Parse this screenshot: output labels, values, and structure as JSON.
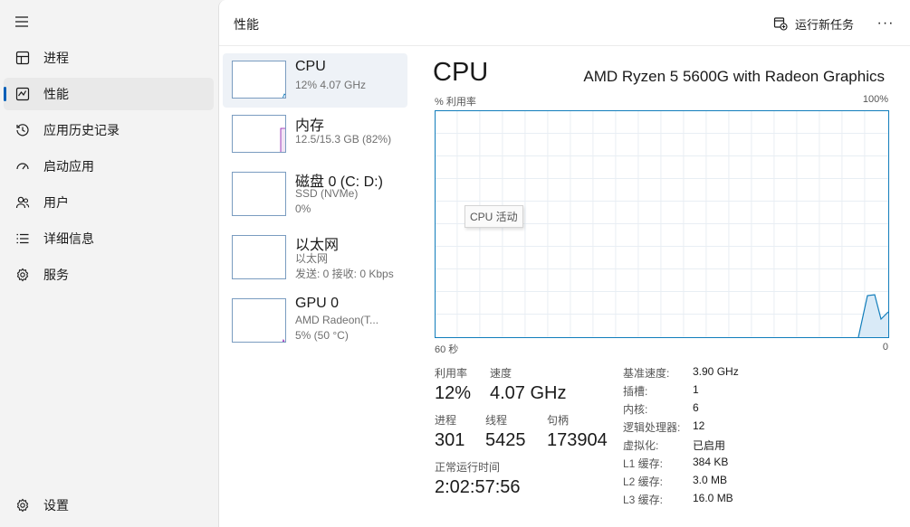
{
  "sidebar": {
    "items": [
      {
        "label": "进程",
        "icon": "processes-icon"
      },
      {
        "label": "性能",
        "icon": "performance-icon"
      },
      {
        "label": "应用历史记录",
        "icon": "history-icon"
      },
      {
        "label": "启动应用",
        "icon": "startup-icon"
      },
      {
        "label": "用户",
        "icon": "users-icon"
      },
      {
        "label": "详细信息",
        "icon": "details-icon"
      },
      {
        "label": "服务",
        "icon": "services-icon"
      }
    ],
    "active_index": 1,
    "settings_label": "设置"
  },
  "header": {
    "title": "性能",
    "run_task_label": "运行新任务",
    "more_label": "···"
  },
  "devices": [
    {
      "name": "CPU",
      "lines": [
        "12% 4.07 GHz"
      ]
    },
    {
      "name": "内存",
      "lines": [
        "12.5/15.3 GB (82%)"
      ]
    },
    {
      "name": "磁盘 0 (C: D:)",
      "lines": [
        "SSD (NVMe)",
        "0%"
      ]
    },
    {
      "name": "以太网",
      "lines": [
        "以太网",
        "发送: 0 接收: 0 Kbps"
      ]
    },
    {
      "name": "GPU 0",
      "lines": [
        "AMD Radeon(T...",
        "5% (50 °C)"
      ]
    }
  ],
  "detail": {
    "title": "CPU",
    "model": "AMD Ryzen 5 5600G with Radeon Graphics",
    "graph_label_left": "% 利用率",
    "graph_label_right": "100%",
    "axis_left": "60 秒",
    "axis_right": "0",
    "tooltip": "CPU 活动",
    "stats": {
      "utilization": {
        "label": "利用率",
        "value": "12%"
      },
      "speed": {
        "label": "速度",
        "value": "4.07 GHz"
      },
      "processes": {
        "label": "进程",
        "value": "301"
      },
      "threads": {
        "label": "线程",
        "value": "5425"
      },
      "handles": {
        "label": "句柄",
        "value": "173904"
      },
      "uptime": {
        "label": "正常运行时间",
        "value": "2:02:57:56"
      }
    },
    "specs": [
      {
        "key": "基准速度:",
        "value": "3.90 GHz"
      },
      {
        "key": "插槽:",
        "value": "1"
      },
      {
        "key": "内核:",
        "value": "6"
      },
      {
        "key": "逻辑处理器:",
        "value": "12"
      },
      {
        "key": "虚拟化:",
        "value": "已启用"
      },
      {
        "key": "L1 缓存:",
        "value": "384 KB"
      },
      {
        "key": "L2 缓存:",
        "value": "3.0 MB"
      },
      {
        "key": "L3 缓存:",
        "value": "16.0 MB"
      }
    ]
  },
  "colors": {
    "cpu_line": "#117dbb",
    "cpu_fill": "#d9eaf7",
    "accent": "#005fb8"
  }
}
